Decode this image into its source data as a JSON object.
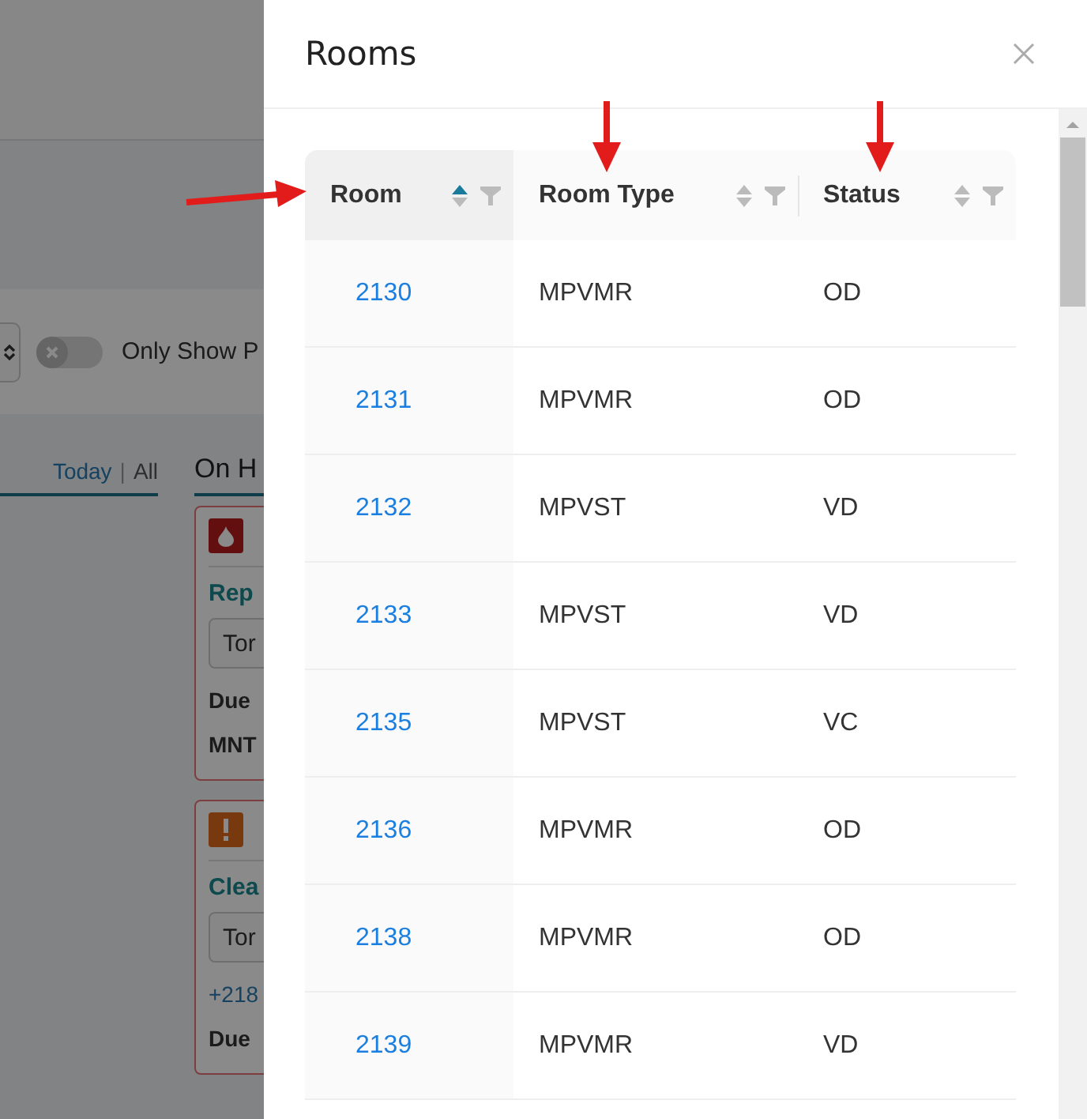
{
  "background": {
    "toggle": {
      "on": false,
      "label": "Only Show P"
    },
    "tabs": [
      {
        "label": "Today",
        "selected": true
      },
      {
        "label": "All",
        "selected": false
      }
    ],
    "tab_separator": "|",
    "heading": "On H",
    "cards": [
      {
        "kind": "fire",
        "title": "Rep",
        "field": "Tor",
        "lines": [
          {
            "kind": "bold",
            "text": "Due"
          },
          {
            "kind": "bold",
            "text": "MNT"
          }
        ]
      },
      {
        "kind": "alert",
        "title": "Clea",
        "field": "Tor",
        "lines": [
          {
            "kind": "link",
            "text": "+218"
          },
          {
            "kind": "bold",
            "text": "Due"
          }
        ]
      }
    ]
  },
  "drawer": {
    "title": "Rooms",
    "table": {
      "columns": [
        {
          "label": "Room",
          "sorted": true
        },
        {
          "label": "Room Type",
          "sorted": false
        },
        {
          "label": "Status",
          "sorted": false
        }
      ],
      "rows": [
        [
          "2130",
          "MPVMR",
          "OD"
        ],
        [
          "2131",
          "MPVMR",
          "OD"
        ],
        [
          "2132",
          "MPVST",
          "VD"
        ],
        [
          "2133",
          "MPVST",
          "VD"
        ],
        [
          "2135",
          "MPVST",
          "VC"
        ],
        [
          "2136",
          "MPVMR",
          "OD"
        ],
        [
          "2138",
          "MPVMR",
          "OD"
        ],
        [
          "2139",
          "MPVMR",
          "VD"
        ]
      ]
    }
  }
}
